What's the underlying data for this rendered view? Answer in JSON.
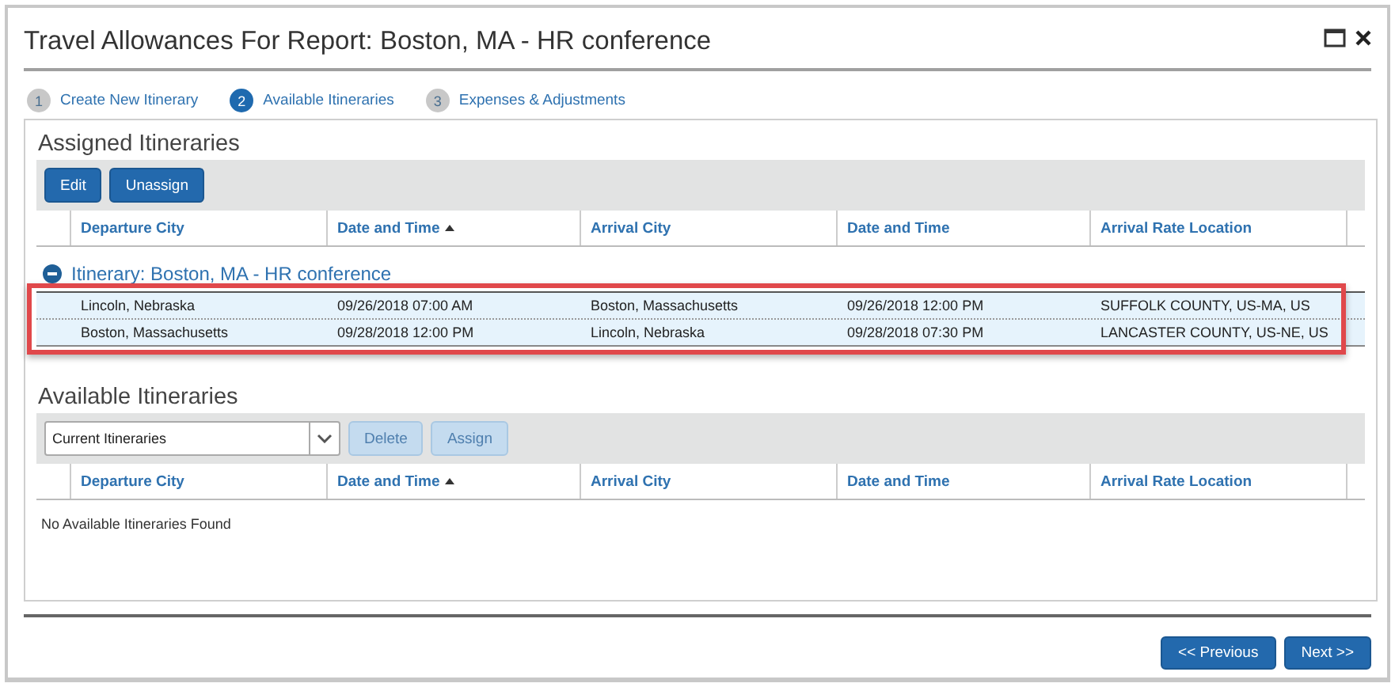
{
  "window": {
    "title": "Travel Allowances For Report: Boston, MA - HR conference"
  },
  "steps": [
    {
      "number": "1",
      "label": "Create New Itinerary",
      "selected": false
    },
    {
      "number": "2",
      "label": "Available Itineraries",
      "selected": true
    },
    {
      "number": "3",
      "label": "Expenses & Adjustments",
      "selected": false
    }
  ],
  "assigned": {
    "title": "Assigned Itineraries",
    "buttons": [
      {
        "label": "Edit",
        "disabled": false
      },
      {
        "label": "Unassign",
        "disabled": false
      }
    ],
    "columns": [
      {
        "label": "Departure City",
        "sorted": false
      },
      {
        "label": "Date and Time",
        "sorted": true
      },
      {
        "label": "Arrival City",
        "sorted": false
      },
      {
        "label": "Date and Time",
        "sorted": false
      },
      {
        "label": "Arrival Rate Location",
        "sorted": false
      }
    ],
    "group": {
      "label": "Itinerary: Boston, MA - HR conference",
      "expanded": true
    },
    "highlighted": true,
    "rows": [
      {
        "cells": [
          "Lincoln, Nebraska",
          "09/26/2018 07:00 AM",
          "Boston, Massachusetts",
          "09/26/2018 12:00 PM",
          "SUFFOLK COUNTY, US-MA, US"
        ],
        "selected": true
      },
      {
        "cells": [
          "Boston, Massachusetts",
          "09/28/2018 12:00 PM",
          "Lincoln, Nebraska",
          "09/28/2018 07:30 PM",
          "LANCASTER COUNTY, US-NE, US"
        ],
        "selected": true
      }
    ]
  },
  "available": {
    "title": "Available Itineraries",
    "filter": {
      "value": "Current Itineraries"
    },
    "buttons": [
      {
        "label": "Delete",
        "disabled": true
      },
      {
        "label": "Assign",
        "disabled": true
      }
    ],
    "columns": [
      {
        "label": "Departure City",
        "sorted": false
      },
      {
        "label": "Date and Time",
        "sorted": true
      },
      {
        "label": "Arrival City",
        "sorted": false
      },
      {
        "label": "Date and Time",
        "sorted": false
      },
      {
        "label": "Arrival Rate Location",
        "sorted": false
      }
    ],
    "empty_message": "No Available Itineraries Found"
  },
  "footer": {
    "buttons": [
      {
        "label": "<< Previous"
      },
      {
        "label": "Next >>"
      }
    ]
  }
}
